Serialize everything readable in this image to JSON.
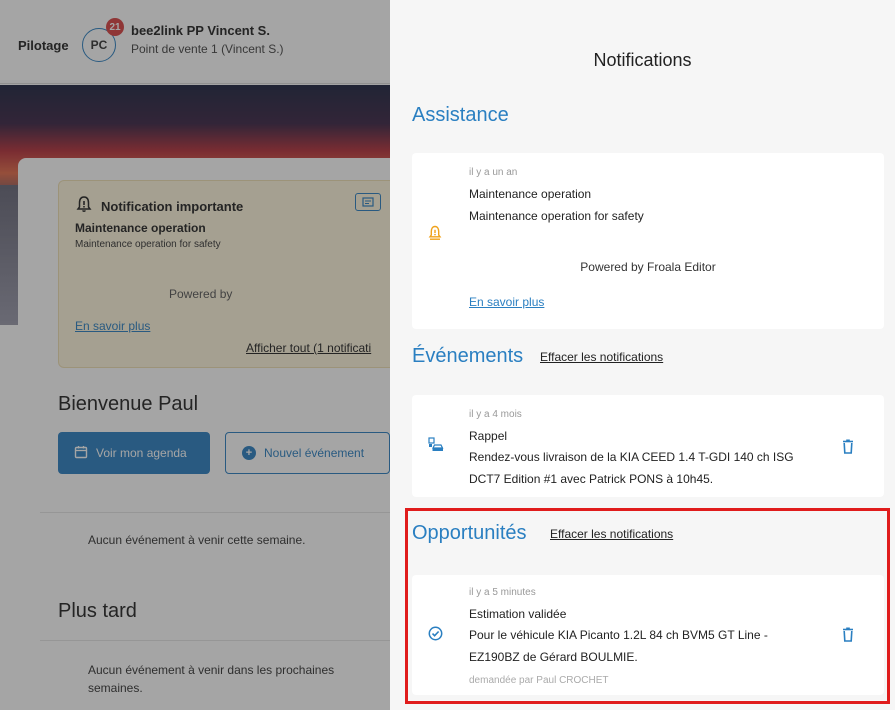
{
  "app": {
    "nav_label": "Pilotage",
    "avatar_initials": "PC",
    "notification_count": "21",
    "user_name": "bee2link PP Vincent S.",
    "user_location": "Point de vente 1 (Vincent S.)"
  },
  "important_notification": {
    "title": "Notification importante",
    "subject": "Maintenance operation",
    "message": "Maintenance operation for safety",
    "powered": "Powered by",
    "learn_more": "En savoir plus",
    "show_all": "Afficher tout (1 notificati"
  },
  "dashboard": {
    "welcome": "Bienvenue Paul",
    "btn_agenda": "Voir mon agenda",
    "btn_new_event": "Nouvel événement",
    "no_event_week": "Aucun événement à venir cette semaine.",
    "later_title": "Plus tard",
    "no_event_later": "Aucun événement à venir dans les prochaines semaines."
  },
  "drawer": {
    "title": "Notifications",
    "sections": {
      "assistance": {
        "title": "Assistance",
        "card": {
          "time": "il y a un an",
          "subject": "Maintenance operation",
          "message": "Maintenance operation for safety",
          "powered": "Powered by Froala Editor",
          "learn_more": "En savoir plus"
        }
      },
      "events": {
        "title": "Événements",
        "clear": "Effacer les notifications",
        "card": {
          "time": "il y a 4 mois",
          "subject": "Rappel",
          "message": "Rendez-vous livraison de la KIA CEED 1.4 T-GDI 140 ch ISG DCT7 Edition #1 avec Patrick PONS à 10h45."
        }
      },
      "opportunities": {
        "title": "Opportunités",
        "clear": "Effacer les notifications",
        "card": {
          "time": "il y a 5 minutes",
          "subject": "Estimation validée",
          "message": "Pour le véhicule KIA Picanto 1.2L 84 ch BVM5 GT Line - EZ190BZ de Gérard BOULMIE.",
          "requested_by": "demandée par Paul CROCHET"
        }
      }
    }
  },
  "colors": {
    "accent": "#2a7fc1",
    "warning": "#f0a21a",
    "highlight": "#e01c1c"
  },
  "icons": [
    "bell-warning-icon",
    "calendar-icon",
    "plus-circle-icon",
    "car-event-icon",
    "check-circle-icon",
    "trash-icon"
  ]
}
